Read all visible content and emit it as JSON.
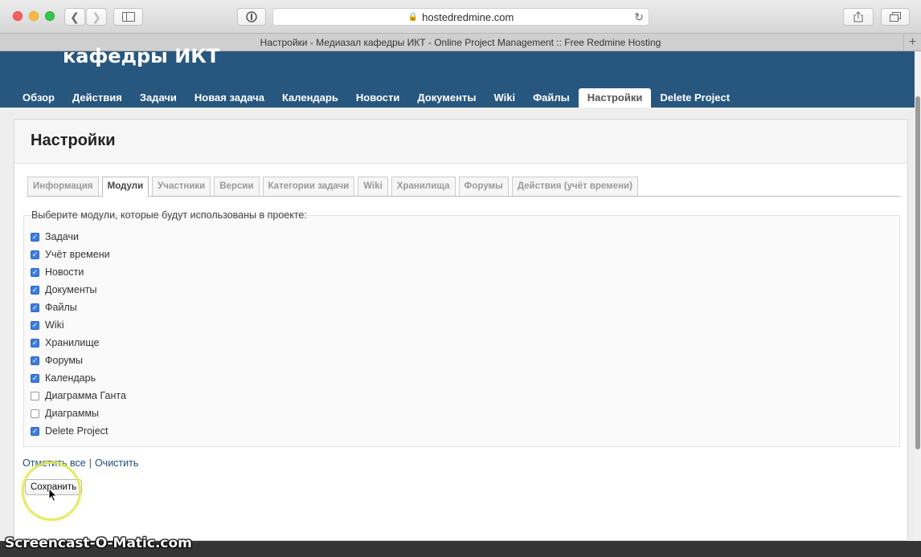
{
  "browser": {
    "address": "hostedredmine.com",
    "tab_title": "Настройки - Медиазал кафедры ИКТ - Online Project Management :: Free Redmine Hosting",
    "new_tab_label": "+"
  },
  "header": {
    "project_title": "кафедры ИКТ",
    "menu": [
      "Обзор",
      "Действия",
      "Задачи",
      "Новая задача",
      "Календарь",
      "Новости",
      "Документы",
      "Wiki",
      "Файлы",
      "Настройки",
      "Delete Project"
    ],
    "selected_menu": "Настройки"
  },
  "page": {
    "title": "Настройки",
    "tabs": [
      "Информация",
      "Модули",
      "Участники",
      "Версии",
      "Категории задачи",
      "Wiki",
      "Хранилища",
      "Форумы",
      "Действия (учёт времени)"
    ],
    "selected_tab": "Модули",
    "legend": "Выберите модули, которые будут использованы в проекте:",
    "modules": [
      {
        "label": "Задачи",
        "checked": true
      },
      {
        "label": "Учёт времени",
        "checked": true
      },
      {
        "label": "Новости",
        "checked": true
      },
      {
        "label": "Документы",
        "checked": true
      },
      {
        "label": "Файлы",
        "checked": true
      },
      {
        "label": "Wiki",
        "checked": true
      },
      {
        "label": "Хранилище",
        "checked": true
      },
      {
        "label": "Форумы",
        "checked": true
      },
      {
        "label": "Календарь",
        "checked": true
      },
      {
        "label": "Диаграмма Ганта",
        "checked": false
      },
      {
        "label": "Диаграммы",
        "checked": false
      },
      {
        "label": "Delete Project",
        "checked": true
      }
    ],
    "check_all": "Отметить все",
    "separator": "|",
    "uncheck_all": "Очистить",
    "save": "Сохранить"
  },
  "watermark": "Screencast-O-Matic.com",
  "colors": {
    "header_bg": "#27577f",
    "checkbox_on": "#3c7ce0",
    "link": "#1c4e7e"
  }
}
